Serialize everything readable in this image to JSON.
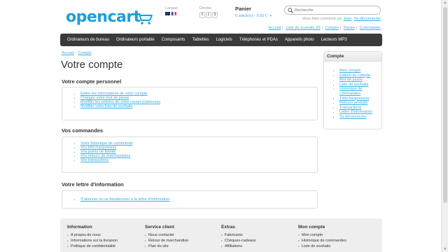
{
  "header": {
    "logo_text": "opencart",
    "language_label": "Langue",
    "currency_label": "Devise",
    "currencies": [
      "€",
      "£",
      "$"
    ],
    "cart_title": "Panier",
    "cart_summary": "0 article(s) - 0.00 €",
    "search_placeholder": "Recherche",
    "welcome_prefix": "Vous êtes connecté sur",
    "welcome_user": "Jean",
    "logout": "Se déconnecter",
    "links": [
      "Accueil",
      "Liste de souhaits (0)",
      "Compte",
      "Panier",
      "Commander"
    ]
  },
  "menu": [
    "Ordinateurs de bureau",
    "Ordinateurs portable",
    "Composants",
    "Tablettes",
    "Logiciels",
    "Téléphones et PDAs",
    "Appareils photo",
    "Lecteurs MP3"
  ],
  "breadcrumb": [
    "Accueil",
    "Compte"
  ],
  "page_title": "Votre compte",
  "sections": {
    "personal": {
      "title": "Votre compte personnel",
      "links": [
        "Éditer les informations de votre compte",
        "Changer votre mot de passe",
        "Modifier les entrées de votre carnet d'adresses",
        "Modifier votre liste de souhaits"
      ]
    },
    "orders": {
      "title": "Vos commandes",
      "links": [
        "Votre historique de commande",
        "Vos téléchargements",
        "Vos points de fidélité",
        "Vos retours de marchandises",
        "Vos transactions"
      ]
    },
    "newsletter": {
      "title": "Votre lettre d'information",
      "links": [
        "S'abonner ou se désabonner à la lettre d'information"
      ]
    }
  },
  "sidebar": {
    "title": "Compte",
    "links": [
      "Mon compte",
      "Édition du compte",
      "Mot de passe",
      "Liste de souhaits",
      "Historique de commandes",
      "Téléchargements",
      "Retours produits",
      "Transactions",
      "Lettre d'information",
      "Se déconnecter"
    ]
  },
  "footer": {
    "columns": [
      {
        "title": "Information",
        "items": [
          "A propos de nous",
          "Informations sur la livraison",
          "Politique de confidentialité"
        ]
      },
      {
        "title": "Service client",
        "items": [
          "Nous contacter",
          "Retour de marchandise",
          "Plan du site"
        ]
      },
      {
        "title": "Extras",
        "items": [
          "Fabricants",
          "Chèques-cadeaux",
          "Affiliations"
        ]
      },
      {
        "title": "Mon compte",
        "items": [
          "Mon compte",
          "Historique de commandes",
          "Liste de souhaits"
        ]
      }
    ]
  },
  "colors": {
    "brand": "#1e9ed9",
    "link": "#38b0e3",
    "menu_bg": "#3a3a3a"
  }
}
